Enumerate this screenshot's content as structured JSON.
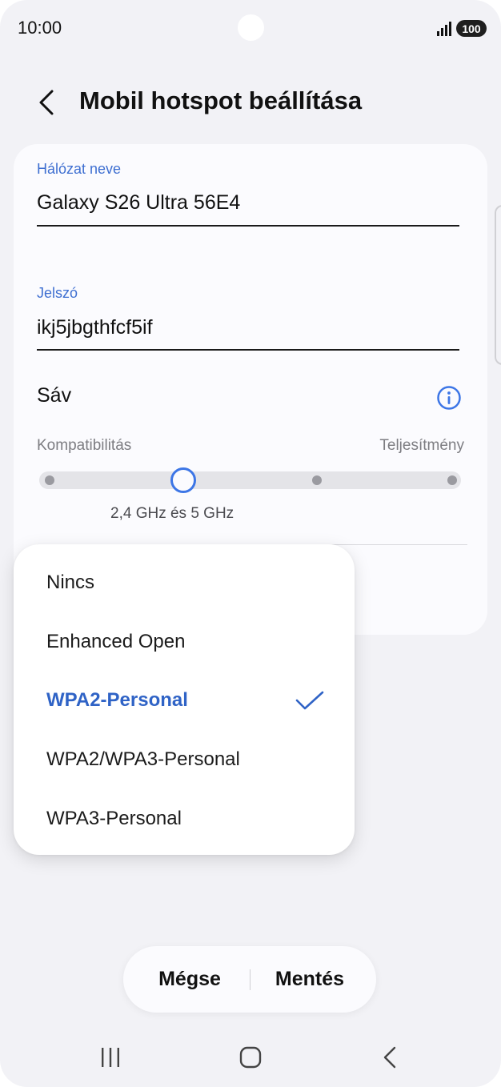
{
  "status_bar": {
    "time": "10:00",
    "battery": "100",
    "signal_icon": "signal-icon"
  },
  "header": {
    "title": "Mobil hotspot beállítása",
    "back_icon": "chevron-left-icon"
  },
  "form": {
    "network_name_label": "Hálózat neve",
    "network_name_value": "Galaxy S26 Ultra 56E4",
    "password_label": "Jelszó",
    "password_value": "ikj5jbgthfcf5if",
    "band_label": "Sáv",
    "band_info_icon": "info-icon",
    "band_scale_left": "Kompatibilitás",
    "band_scale_right": "Teljesítmény",
    "band_selected": "2,4 GHz és 5 GHz",
    "band_slider_positions": 4,
    "band_slider_selected_index": 1
  },
  "security_dropdown": {
    "options": [
      {
        "label": "Nincs",
        "selected": false
      },
      {
        "label": "Enhanced Open",
        "selected": false
      },
      {
        "label": "WPA2-Personal",
        "selected": true
      },
      {
        "label": "WPA2/WPA3-Personal",
        "selected": false
      },
      {
        "label": "WPA3-Personal",
        "selected": false
      }
    ],
    "check_icon": "check-icon"
  },
  "actions": {
    "cancel": "Mégse",
    "save": "Mentés"
  },
  "navigation": {
    "recents_icon": "recents-icon",
    "home_icon": "home-icon",
    "back_icon": "back-icon"
  },
  "colors": {
    "accent": "#3e6fd1",
    "selected_text": "#2f63c6",
    "background": "#f2f2f6",
    "card": "#fbfbfe"
  }
}
